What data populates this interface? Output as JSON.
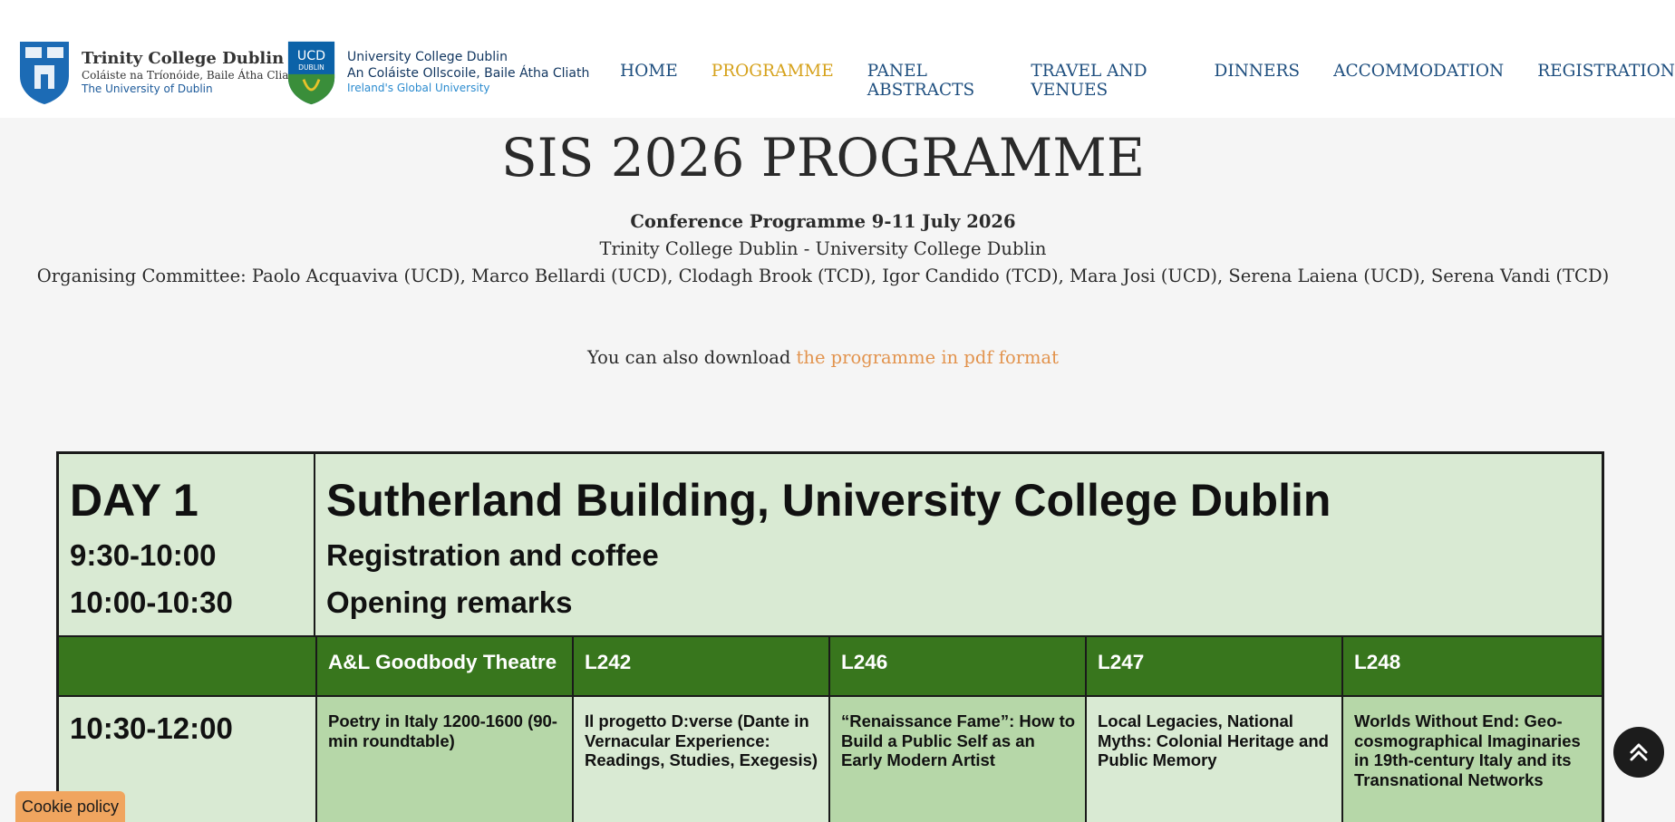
{
  "logos": {
    "tcd": {
      "title": "Trinity College Dublin",
      "subtitle": "Coláiste na Tríonóide, Baile Átha Cliath",
      "tagline": "The University of Dublin"
    },
    "ucd": {
      "crest_text_top": "UCD",
      "crest_text_bottom": "DUBLIN",
      "line1": "University College Dublin",
      "line2": "An Coláiste Ollscoile, Baile Átha Cliath",
      "tagline": "Ireland's Global University"
    }
  },
  "nav": {
    "items": [
      "HOME",
      "PROGRAMME",
      "PANEL ABSTRACTS",
      "TRAVEL AND VENUES",
      "DINNERS",
      "ACCOMMODATION",
      "REGISTRATION"
    ],
    "active": "PROGRAMME"
  },
  "page": {
    "title": "SIS 2026 PROGRAMME",
    "conference_title": "Conference Programme 9-11 July 2026",
    "institutions": "Trinity College Dublin - University College Dublin",
    "committee": "Organising Committee: Paolo Acquaviva (UCD), Marco Bellardi (UCD), Clodagh Brook (TCD), Igor Candido (TCD), Mara Josi (UCD), Serena Laiena (UCD), Serena Vandi (TCD)",
    "download_prefix": "You can also download ",
    "download_link": "the programme in pdf format"
  },
  "programme": {
    "day": "DAY 1",
    "venue": "Sutherland Building, University College Dublin",
    "opening": [
      {
        "time": "9:30-10:00",
        "event": "Registration and coffee"
      },
      {
        "time": "10:00-10:30",
        "event": "Opening remarks"
      }
    ],
    "rooms": [
      "A&L Goodbody Theatre",
      "L242",
      "L246",
      "L247",
      "L248"
    ],
    "session": {
      "time": "10:30-12:00",
      "panels": [
        "Poetry in Italy 1200-1600 (90-min roundtable)",
        "Il progetto D:verse (Dante in Vernacular Experience: Readings, Studies, Exegesis)",
        "“Renaissance Fame”: How to Build a Public Self as an Early Modern Artist",
        "Local Legacies, National Myths: Colonial Heritage and Public Memory",
        "Worlds Without End: Geo-cosmographical Imaginaries in 19th-century Italy and its Transnational Networks"
      ]
    },
    "colors": {
      "light": "#d9ead3",
      "medium": "#b6d7a8",
      "header": "#38761d"
    }
  },
  "footer": {
    "cookie_label": "Cookie policy",
    "scroll_top_icon": "double-chevron-up-icon"
  }
}
